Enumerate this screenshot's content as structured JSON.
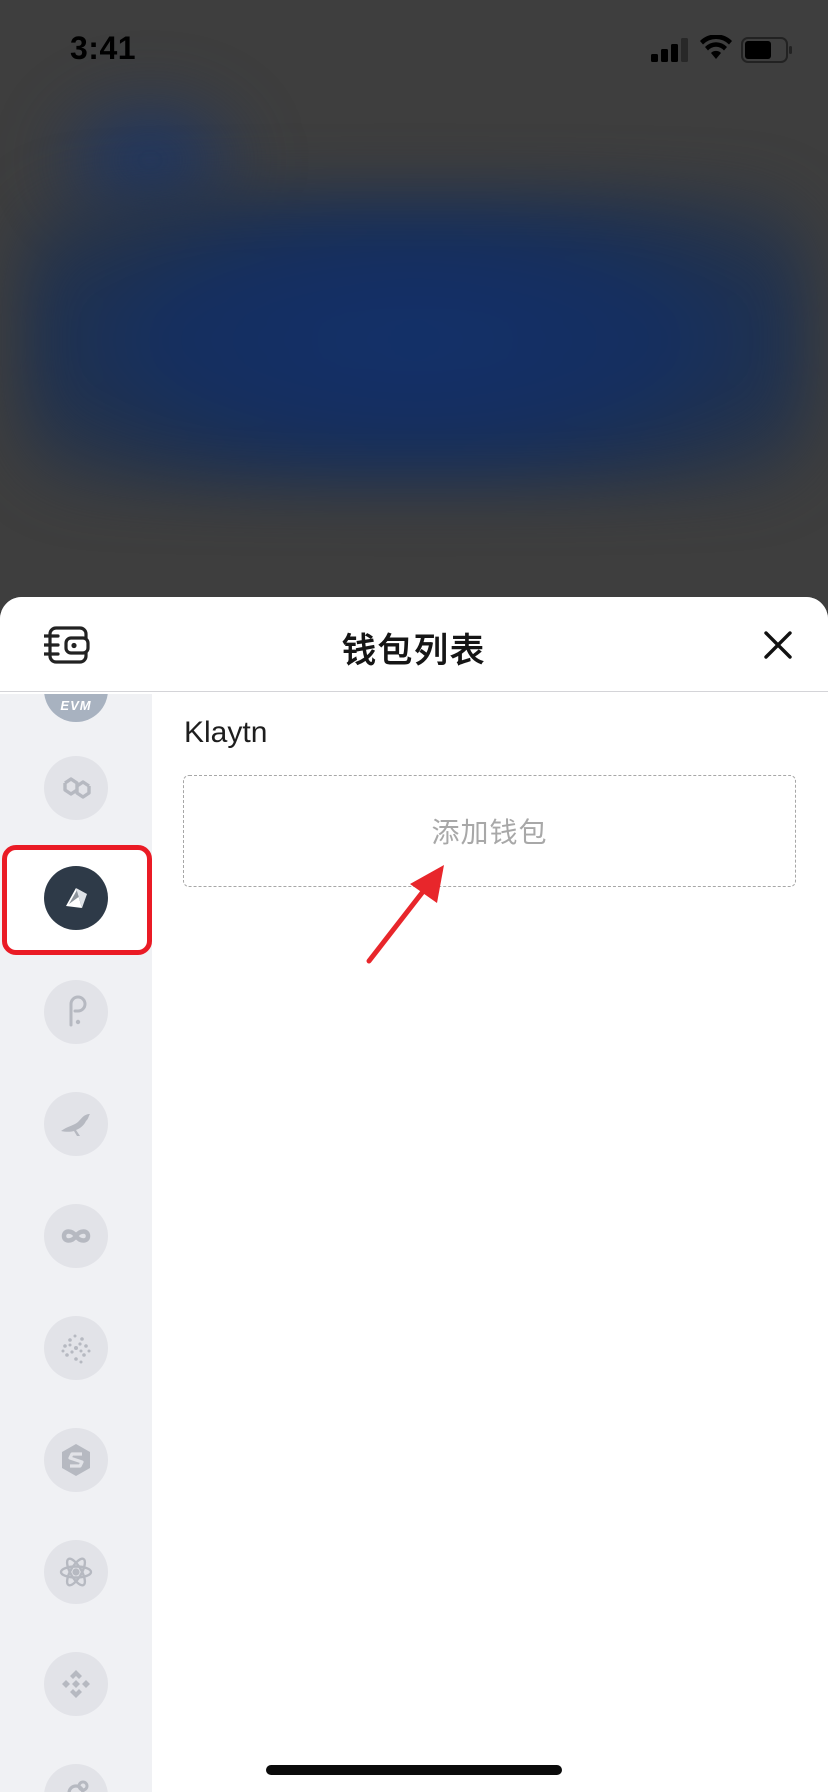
{
  "status_bar": {
    "time": "3:41",
    "icons": [
      "signal-icon",
      "wifi-icon",
      "battery-icon"
    ]
  },
  "sheet": {
    "title": "钱包列表",
    "left_icon": "wallet-list-icon",
    "close_icon": "close-icon"
  },
  "chains": [
    {
      "name": "evm-chain-icon",
      "label": "EVM",
      "selected": false
    },
    {
      "name": "polygon-chain-icon",
      "selected": false
    },
    {
      "name": "klaytn-chain-icon",
      "selected": true
    },
    {
      "name": "polkadot-chain-icon",
      "selected": false
    },
    {
      "name": "kusama-chain-icon",
      "selected": false
    },
    {
      "name": "infinity-chain-icon",
      "selected": false
    },
    {
      "name": "iotex-chain-icon",
      "selected": false
    },
    {
      "name": "s-hexagon-chain-icon",
      "selected": false
    },
    {
      "name": "cosmos-chain-icon",
      "selected": false
    },
    {
      "name": "binance-chain-icon",
      "selected": false
    },
    {
      "name": "partial-chain-icon",
      "selected": false
    }
  ],
  "content": {
    "chain_name": "Klaytn",
    "add_wallet_label": "添加钱包"
  },
  "colors": {
    "highlight_frame": "#ea1b25",
    "sidebar_bg": "#f0f1f4",
    "selected_chain_bg": "#2e3a48",
    "arrow": "#e8262b"
  }
}
